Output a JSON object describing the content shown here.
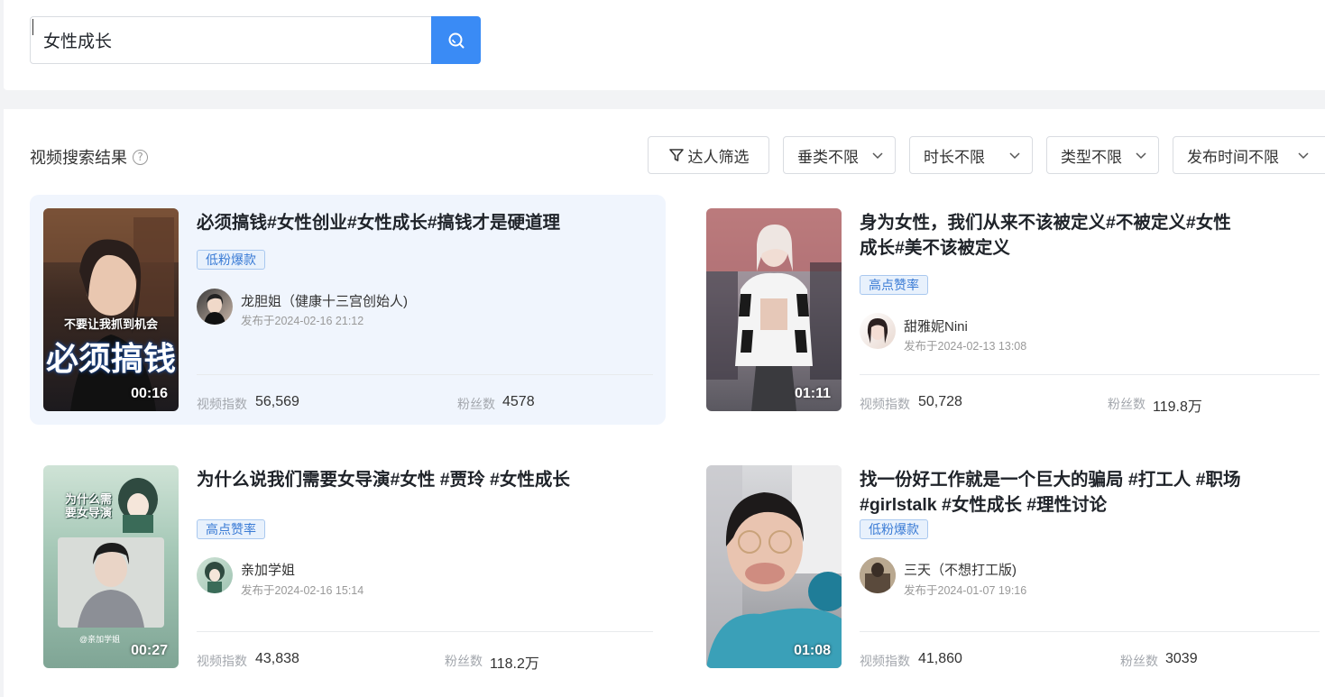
{
  "search": {
    "value": "女性成长"
  },
  "results": {
    "title": "视频搜索结果",
    "help": "?",
    "filters": {
      "talent": "达人筛选",
      "vertical": "垂类不限",
      "duration": "时长不限",
      "type": "类型不限",
      "publish_time": "发布时间不限"
    }
  },
  "labels": {
    "video_index": "视频指数",
    "fans": "粉丝数"
  },
  "cards": [
    {
      "title": "必须搞钱#女性创业#女性成长#搞钱才是硬道理",
      "tag": "低粉爆款",
      "author": "龙胆姐（健康十三宫创始人)",
      "date": "发布于2024-02-16 21:12",
      "duration": "00:16",
      "thumb_caption_1": "不要让我抓到机会",
      "thumb_caption_2": "必须搞钱",
      "video_index": "56,569",
      "fans": "4578"
    },
    {
      "title": "身为女性，我们从来不该被定义#不被定义#女性成长#美不该被定义",
      "tag": "高点赞率",
      "author": "甜雅妮Nini",
      "date": "发布于2024-02-13 13:08",
      "duration": "01:11",
      "video_index": "50,728",
      "fans": "119.8万"
    },
    {
      "title": "为什么说我们需要女导演#女性 #贾玲 #女性成长",
      "tag": "高点赞率",
      "author": "亲加学姐",
      "date": "发布于2024-02-16 15:14",
      "duration": "00:27",
      "thumb_caption_1": "为什么需要女导演",
      "thumb_caption_2": "@亲加学姐",
      "video_index": "43,838",
      "fans": "118.2万"
    },
    {
      "title": "找一份好工作就是一个巨大的骗局 #打工人 #职场 #girlstalk #女性成长 #理性讨论",
      "tag": "低粉爆款",
      "author": "三天（不想打工版)",
      "date": "发布于2024-01-07 19:16",
      "duration": "01:08",
      "video_index": "41,860",
      "fans": "3039"
    }
  ],
  "colors": {
    "accent": "#3a8bf5",
    "active_card": "#f0f5fd",
    "tag_text": "#3a7bd5"
  }
}
